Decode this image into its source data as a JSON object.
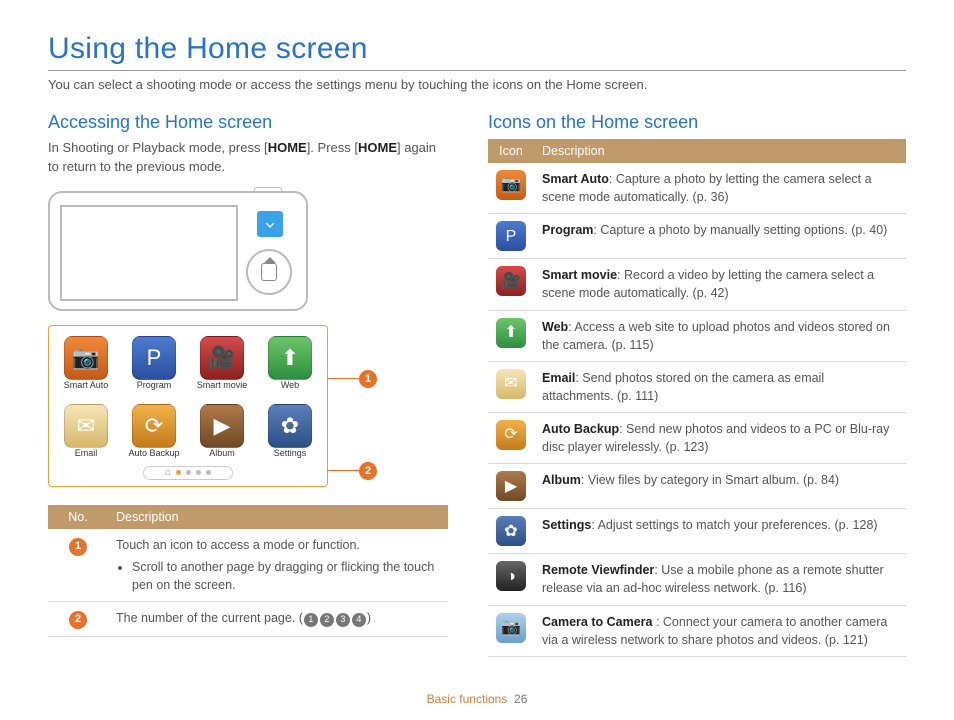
{
  "title": "Using the Home screen",
  "intro": "You can select a shooting mode or access the settings menu by touching the icons on the Home screen.",
  "left": {
    "subhead": "Accessing the Home screen",
    "text_pre": "In Shooting or Playback mode, press [",
    "key1": "HOME",
    "text_mid": "]. Press [",
    "key2": "HOME",
    "text_post": "] again to return to the previous mode.",
    "apps": {
      "smartauto": "Smart Auto",
      "program": "Program",
      "smartmovie": "Smart movie",
      "web": "Web",
      "email": "Email",
      "backup": "Auto Backup",
      "album": "Album",
      "settings": "Settings"
    },
    "table": {
      "h1": "No.",
      "h2": "Description",
      "rows": [
        {
          "badge": "1",
          "text": "Touch an icon to access a mode or function.",
          "bullet": "Scroll to another page by dragging or flicking the touch pen on the screen."
        },
        {
          "badge": "2",
          "text": "The number of the current page. (",
          "pager": [
            "1",
            "2",
            "3",
            "4"
          ],
          "text_end": ")"
        }
      ]
    }
  },
  "right": {
    "subhead": "Icons on the Home screen",
    "table": {
      "h1": "Icon",
      "h2": "Description",
      "rows": [
        {
          "ico": "smartauto",
          "glyph": "📷",
          "bold": "Smart Auto",
          "text": ": Capture a photo by letting the camera select a scene mode automatically. (p. 36)"
        },
        {
          "ico": "program",
          "glyph": "P",
          "bold": "Program",
          "text": ": Capture a photo by manually setting options. (p. 40)"
        },
        {
          "ico": "smartmovie",
          "glyph": "🎥",
          "bold": "Smart movie",
          "text": ": Record a video by letting the camera select a scene mode automatically. (p. 42)"
        },
        {
          "ico": "web",
          "glyph": "⬆",
          "bold": "Web",
          "text": ": Access a web site to upload photos and videos stored on the camera. (p. 115)"
        },
        {
          "ico": "email",
          "glyph": "✉",
          "bold": "Email",
          "text": ": Send photos stored on the camera as email attachments. (p. 111)"
        },
        {
          "ico": "backup",
          "glyph": "⟳",
          "bold": "Auto Backup",
          "text": ": Send new photos and videos to a PC or Blu-ray disc player wirelessly. (p. 123)"
        },
        {
          "ico": "album",
          "glyph": "▶",
          "bold": "Album",
          "text": ": View files by category in Smart album. (p. 84)"
        },
        {
          "ico": "settings",
          "glyph": "✿",
          "bold": "Settings",
          "text": ": Adjust settings to match your preferences. (p. 128)"
        },
        {
          "ico": "remote",
          "glyph": "◑",
          "bold": "Remote Viewfinder",
          "text": ": Use a mobile phone as a remote shutter release via an ad-hoc wireless network. (p. 116)"
        },
        {
          "ico": "camcam",
          "glyph": "📷",
          "bold": "Camera to Camera ",
          "text": ": Connect your camera to another camera via a wireless network to share photos and videos. (p. 121)"
        }
      ]
    }
  },
  "footer": {
    "section": "Basic functions",
    "page": "26"
  }
}
